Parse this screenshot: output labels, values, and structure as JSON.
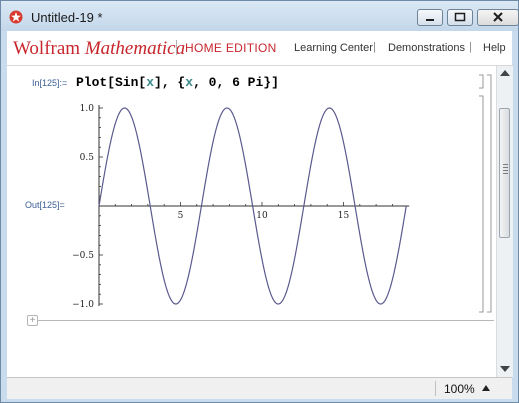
{
  "window": {
    "title": "Untitled-19 *"
  },
  "header": {
    "brand_wolfram": "Wolfram",
    "brand_mathematica": "Mathematica",
    "edition": "HOME EDITION",
    "links": [
      "Learning Center",
      "Demonstrations",
      "Help"
    ],
    "separator": "|"
  },
  "cell": {
    "in_label": "In[125]:=",
    "input_parts": [
      "Plot[Sin[",
      "x",
      "], {",
      "x",
      ", 0, 6 Pi}]"
    ],
    "out_label": "Out[125]="
  },
  "status": {
    "zoom": "100%"
  },
  "colors": {
    "brand": "#c8262d",
    "curve": "#5b5a8e",
    "cell_label": "#3c5f93"
  },
  "chart_data": {
    "type": "line",
    "function": "Sin[x]",
    "x_range": [
      0,
      18.8496
    ],
    "ylim": [
      -1.0,
      1.0
    ],
    "x_ticks": [
      5,
      10,
      15
    ],
    "x_tick_labels": [
      "5",
      "10",
      "15"
    ],
    "y_ticks": [
      -1.0,
      -0.5,
      0.5,
      1.0
    ],
    "y_tick_labels": [
      "−1.0",
      "−0.5",
      "0.5",
      "1.0"
    ],
    "series": [
      {
        "x": [
          0,
          0.785,
          1.571,
          2.356,
          3.142,
          3.927,
          4.712,
          5.498,
          6.283,
          7.069,
          7.854,
          8.639,
          9.425,
          10.21,
          10.996,
          11.781,
          12.566,
          13.352,
          14.137,
          14.923,
          15.708,
          16.493,
          17.279,
          18.064,
          18.85
        ],
        "y": [
          0,
          0.707,
          1,
          0.707,
          0,
          -0.707,
          -1,
          -0.707,
          0,
          0.707,
          1,
          0.707,
          0,
          -0.707,
          -1,
          -0.707,
          0,
          0.707,
          1,
          0.707,
          0,
          -0.707,
          -1,
          -0.707,
          0
        ]
      }
    ],
    "grid": false
  }
}
